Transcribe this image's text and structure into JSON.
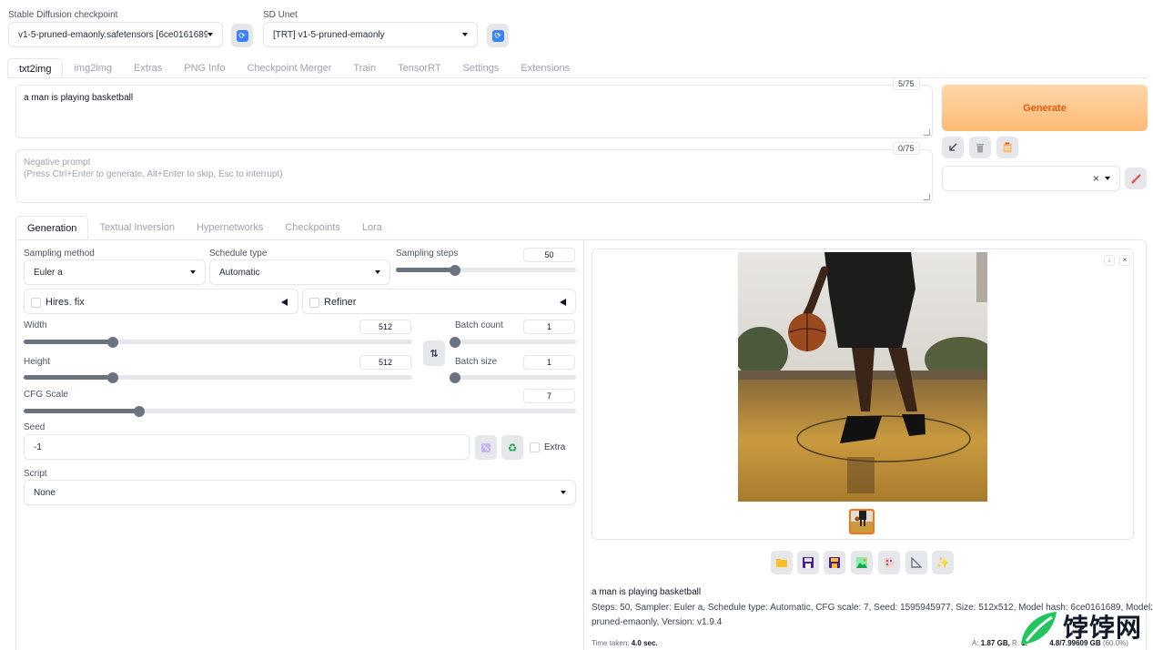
{
  "checkpoint": {
    "label": "Stable Diffusion checkpoint",
    "value": "v1-5-pruned-emaonly.safetensors [6ce0161689]"
  },
  "sd_unet": {
    "label": "SD Unet",
    "value": "[TRT] v1-5-pruned-emaonly"
  },
  "main_tabs": [
    "txt2img",
    "img2img",
    "Extras",
    "PNG Info",
    "Checkpoint Merger",
    "Train",
    "TensorRT",
    "Settings",
    "Extensions"
  ],
  "prompt": {
    "value": "a man is playing basketball",
    "counter": "5/75"
  },
  "negative_prompt": {
    "placeholder_line1": "Negative prompt",
    "placeholder_line2": "(Press Ctrl+Enter to generate, Alt+Enter to skip, Esc to interrupt)",
    "counter": "0/75"
  },
  "generate_label": "Generate",
  "styles": {
    "clear_symbol": "×"
  },
  "sub_tabs": [
    "Generation",
    "Textual Inversion",
    "Hypernetworks",
    "Checkpoints",
    "Lora"
  ],
  "params": {
    "sampling_method_label": "Sampling method",
    "sampling_method": "Euler a",
    "schedule_type_label": "Schedule type",
    "schedule_type": "Automatic",
    "sampling_steps_label": "Sampling steps",
    "sampling_steps": "50",
    "hires_fix_label": "Hires. fix",
    "refiner_label": "Refiner",
    "width_label": "Width",
    "width": "512",
    "height_label": "Height",
    "height": "512",
    "batch_count_label": "Batch count",
    "batch_count": "1",
    "batch_size_label": "Batch size",
    "batch_size": "1",
    "cfg_scale_label": "CFG Scale",
    "cfg_scale": "7",
    "seed_label": "Seed",
    "seed": "-1",
    "extra_label": "Extra",
    "script_label": "Script",
    "script": "None"
  },
  "sliders": {
    "sampling_steps_fraction": 0.33,
    "width_fraction": 0.23,
    "height_fraction": 0.23,
    "batch_count_fraction": 0.0,
    "batch_size_fraction": 0.0,
    "cfg_scale_fraction": 0.21
  },
  "output": {
    "caption_prompt": "a man is playing basketball",
    "caption_params": "Steps: 50, Sampler: Euler a, Schedule type: Automatic, CFG scale: 7, Seed: 1595945977, Size: 512x512, Model hash: 6ce0161689, Model: v1-5-",
    "caption_params_2": "pruned-emaonly, Version: v1.9.4",
    "time_taken_label": "Time taken:",
    "time_taken_value": "4.0 sec.",
    "vram_a_label": "A:",
    "vram_a_value": "1.87 GB,",
    "vram_r_label": "R:",
    "vram_r_value": "1.",
    "vram_sys_value": "4.8/7.99609 GB",
    "vram_sys_pct": "(60.0%)"
  },
  "watermark": {
    "text": "饽饽网"
  },
  "colors": {
    "accent_blue": "#3b82f6",
    "generate_from": "#fed7aa",
    "generate_to": "#fdba74",
    "generate_text": "#ea580c",
    "paint_red": "#ef4444"
  },
  "icons": {
    "refresh": "refresh-icon",
    "arrow": "arrow-icon",
    "trash": "trash-icon",
    "clipboard": "clipboard-icon",
    "paint": "paint-brush-icon",
    "swap": "swap-icon",
    "dice": "dice-icon",
    "recycle": "recycle-icon",
    "folder": "folder-icon",
    "save": "save-icon",
    "zip": "zip-icon",
    "image": "image-icon",
    "palette": "palette-icon",
    "triangle_ruler": "ruler-icon",
    "sparkle": "sparkle-icon"
  }
}
